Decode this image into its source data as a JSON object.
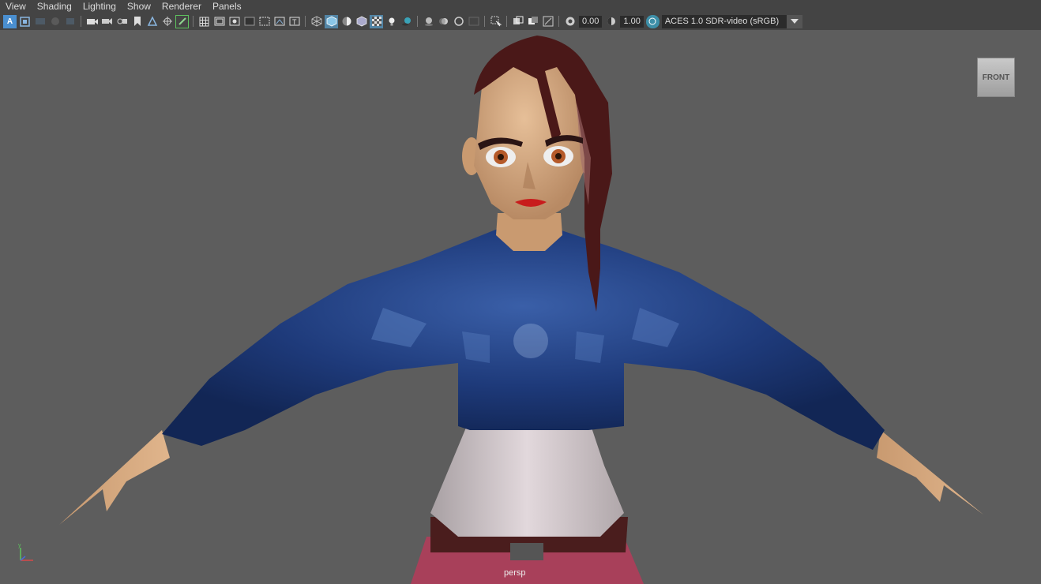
{
  "menu": {
    "items": [
      "View",
      "Shading",
      "Lighting",
      "Show",
      "Renderer",
      "Panels"
    ]
  },
  "toolbar": {
    "exposure": "0.00",
    "gamma": "1.00",
    "color_space": "ACES 1.0 SDR-video (sRGB)"
  },
  "viewport": {
    "view_cube_label": "FRONT",
    "camera_label": "persp",
    "axis_y": "y",
    "background_color": "#5d5d5d",
    "character": {
      "shirt_color": "#1e3a7a",
      "skin_color": "#d0a47e",
      "hair_color": "#4a1818",
      "apron_color": "#cfc5c8",
      "pants_color": "#a8405a"
    }
  }
}
